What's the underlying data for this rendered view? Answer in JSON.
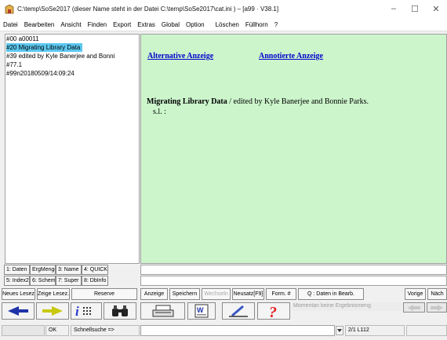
{
  "window": {
    "title": "C:\\temp\\SoSe2017   (dieser Name steht in der Datei C:\\temp\\SoSe2017\\cat.ini ) – [a99 · V38.1]",
    "controls": [
      "–",
      "☐",
      "✕"
    ]
  },
  "menu": [
    "Datei",
    "Bearbeiten",
    "Ansicht",
    "Finden",
    "Export",
    "Extras",
    "Global",
    "Option",
    "Löschen",
    "Füllhorn",
    "?"
  ],
  "record_list": [
    "#00 a00011",
    "#20 Migrating Library Data",
    "#39 edited by Kyle Banerjee and Bonni",
    "#77.1",
    "#99n20180509/14:09:24"
  ],
  "display": {
    "link_alt": "Alternative Anzeige",
    "link_annot": "Annotierte Anzeige",
    "title": "Migrating Library Data",
    "resp": " / edited by Kyle Banerjee and Bonnie Parks.",
    "place": "s.l. :"
  },
  "index_tabs_row1": [
    "1: Daten",
    "ErgMenge",
    "3: Name",
    "4: QUICK"
  ],
  "index_tabs_row2": [
    "5: Index2",
    "6: Schema",
    "7: Super",
    "8: DbInfo"
  ],
  "buttons": [
    "Neues Lesez",
    "Zeige Lesez.",
    "Reserve",
    "Anzeige",
    "Speichern",
    "Wechseln",
    "Neusatz[F9]",
    "Form. #",
    "Q : Daten in Bearb.",
    "Vorige",
    "Näch"
  ],
  "status": {
    "ok": "OK",
    "quicksearch": "Schnellsuche =>",
    "info": "Momentan keine Ergebnismeng",
    "position": "2/1 L112"
  }
}
